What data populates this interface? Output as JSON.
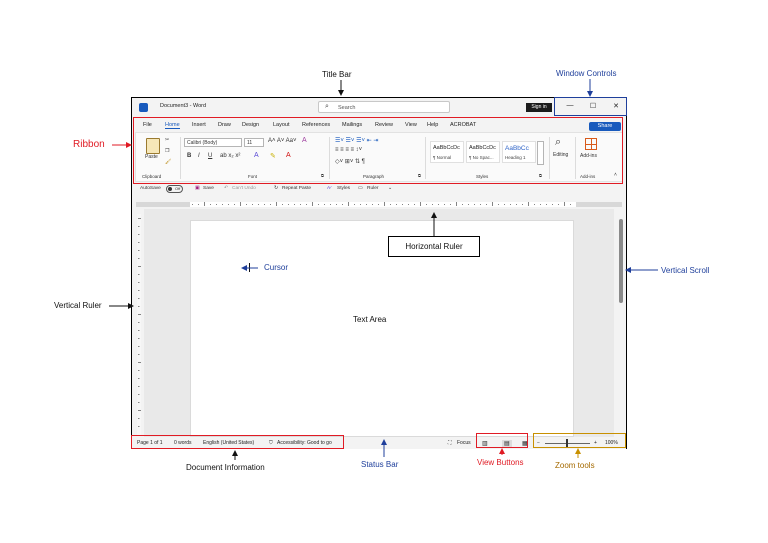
{
  "annotations": {
    "title_bar": "Title Bar",
    "window_controls": "Window Controls",
    "ribbon": "Ribbon",
    "horizontal_ruler": "Horizontal Ruler",
    "cursor": "Cursor",
    "vertical_scroll": "Vertical Scroll",
    "vertical_ruler": "Vertical Ruler",
    "text_area": "Text Area",
    "document_information": "Document Information",
    "status_bar": "Status Bar",
    "view_buttons": "View Buttons",
    "zoom_tools": "Zoom tools"
  },
  "window": {
    "title": "Document3 - Word",
    "search_placeholder": "Search",
    "sign_in": "Sign in",
    "minimize": "—",
    "maximize": "☐",
    "close": "✕"
  },
  "menu": [
    "File",
    "Home",
    "Insert",
    "Draw",
    "Design",
    "Layout",
    "References",
    "Mailings",
    "Review",
    "View",
    "Help",
    "ACROBAT"
  ],
  "share": "Share",
  "ribbon": {
    "paste": "Paste",
    "clipboard": "Clipboard",
    "font_name": "Calibri (Body)",
    "font_size": "11",
    "font": "Font",
    "paragraph": "Paragraph",
    "styles_group": "Styles",
    "styles": [
      {
        "preview": "AaBbCcDc",
        "name": "¶ Normal"
      },
      {
        "preview": "AaBbCcDc",
        "name": "¶ No Spac..."
      },
      {
        "preview": "AaBbCc",
        "name": "Heading 1"
      }
    ],
    "editing": "Editing",
    "addins_button": "Add-ins",
    "addins_group": "Add-ins"
  },
  "qat": {
    "autosave": "AutoSave",
    "toggle": "Off",
    "save": "Save",
    "undo": "Can't Undo",
    "repeat": "Repeat Paste",
    "styles": "Styles",
    "ruler": "Ruler"
  },
  "status": {
    "page": "Page 1 of 1",
    "words": "0 words",
    "language": "English (United States)",
    "accessibility": "Accessibility: Good to go",
    "focus": "Focus",
    "zoom": "100%"
  },
  "colors": {
    "accent_red": "#e01b24",
    "accent_navy": "#1f3f9b",
    "accent_gold": "#c89000",
    "word_blue": "#185abd"
  }
}
